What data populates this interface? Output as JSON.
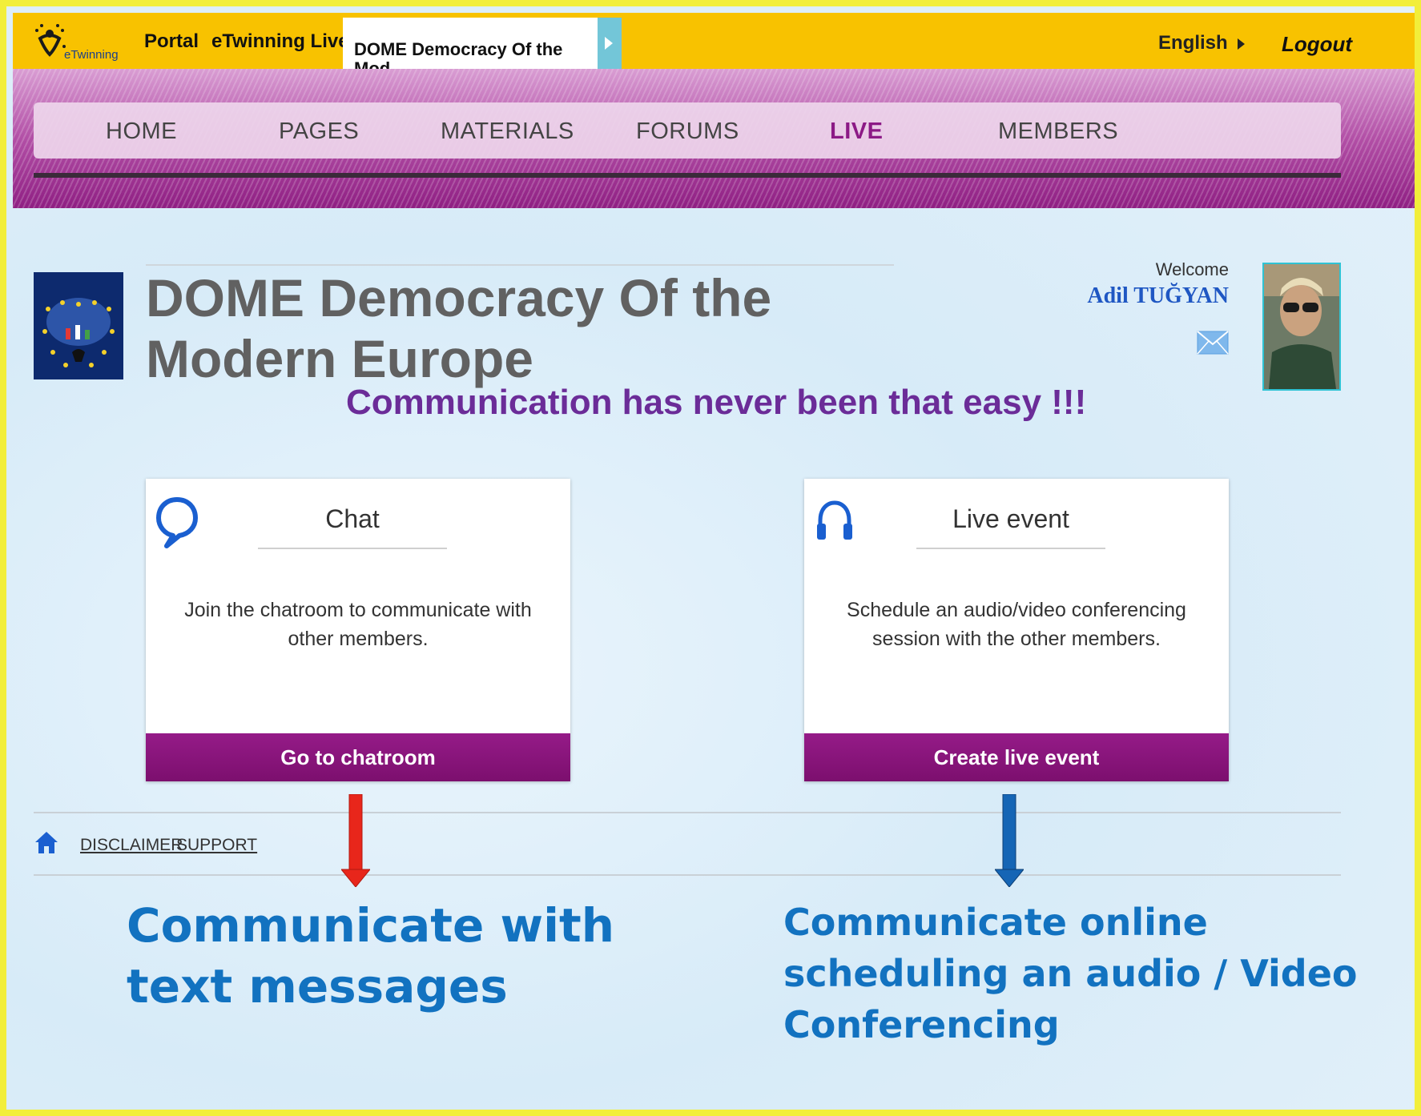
{
  "topbar": {
    "logo_text": "eTwinning",
    "portal": "Portal",
    "etwinning_live": "eTwinning Live",
    "project_tab": "DOME Democracy Of the Mod...",
    "language": "English",
    "logout": "Logout"
  },
  "nav": {
    "items": [
      "HOME",
      "PAGES",
      "MATERIALS",
      "FORUMS",
      "LIVE",
      "MEMBERS"
    ],
    "active": "LIVE"
  },
  "project": {
    "title": "DOME Democracy Of the Modern Europe"
  },
  "user": {
    "welcome": "Welcome",
    "name": "Adil TUĞYAN"
  },
  "slogan": "Communication has never been that easy !!!",
  "cards": [
    {
      "icon": "chat-bubble-icon",
      "title": "Chat",
      "description": "Join the chatroom to communicate with other members.",
      "button": "Go to chatroom"
    },
    {
      "icon": "headphones-icon",
      "title": "Live event",
      "description": "Schedule an audio/video conferencing session with the other members.",
      "button": "Create live event"
    }
  ],
  "footer": {
    "disclaimer": "DISCLAIMER",
    "support": "SUPPORT"
  },
  "annotations": {
    "left": "Communicate with text messages",
    "right": "Communicate online scheduling an audio / Video Conferencing"
  },
  "colors": {
    "topbar": "#f8c200",
    "brand_purple": "#8c1a86",
    "slogan": "#6b2c98",
    "annotation_blue": "#1272c0",
    "arrow_red": "#e8261b",
    "arrow_blue": "#1565b5"
  }
}
